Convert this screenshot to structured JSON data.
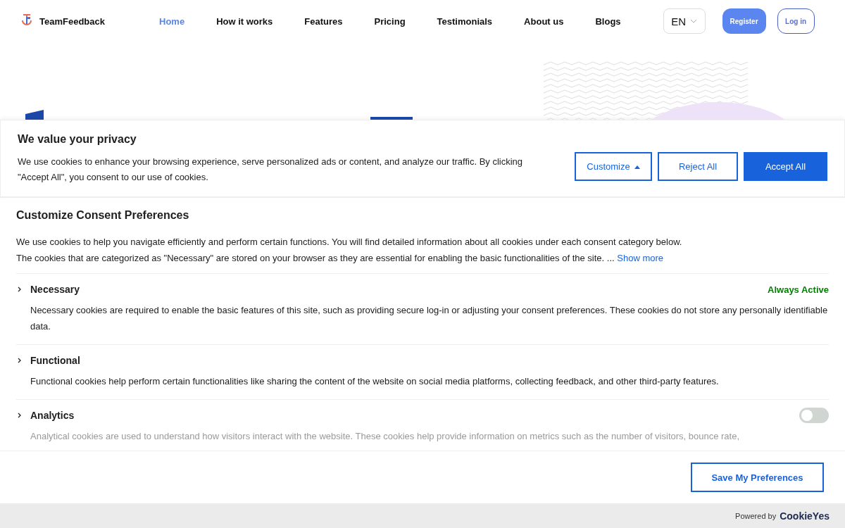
{
  "nav": {
    "brand": "TeamFeedback",
    "items": [
      {
        "label": "Home",
        "selected": true
      },
      {
        "label": "How it works",
        "selected": false
      },
      {
        "label": "Features",
        "selected": false
      },
      {
        "label": "Pricing",
        "selected": false
      },
      {
        "label": "Testimonials",
        "selected": false
      },
      {
        "label": "About us",
        "selected": false
      },
      {
        "label": "Blogs",
        "selected": false
      }
    ],
    "language": "EN",
    "register": "Register",
    "login": "Log in"
  },
  "banner": {
    "title": "We value your privacy",
    "text": "We use cookies to enhance your browsing experience, serve personalized ads or content, and analyze our traffic. By clicking \"Accept All\", you consent to our use of cookies.",
    "customize": {
      "label": "Customize",
      "expanded": true
    },
    "reject": "Reject All",
    "accept": "Accept All"
  },
  "preferences": {
    "title": "Customize Consent Preferences",
    "intro": "We use cookies to help you navigate efficiently and perform certain functions. You will find detailed information about all cookies under each consent category below.",
    "intro2": "The cookies that are categorized as \"Necessary\" are stored on your browser as they are essential for enabling the basic functionalities of the site. ...",
    "show_more": "Show more",
    "categories": [
      {
        "name": "Necessary",
        "kind": "always",
        "status": "Always Active",
        "expanded": false,
        "description": "Necessary cookies are required to enable the basic features of this site, such as providing secure log-in or adjusting your consent preferences. These cookies do not store any personally identifiable data."
      },
      {
        "name": "Functional",
        "kind": "plain",
        "expanded": false,
        "description": "Functional cookies help perform certain functionalities like sharing the content of the website on social media platforms, collecting feedback, and other third-party features."
      },
      {
        "name": "Analytics",
        "kind": "toggle",
        "on": false,
        "expanded": false,
        "description": "Analytical cookies are used to understand how visitors interact with the website. These cookies help provide information on metrics such as the number of visitors, bounce rate,"
      }
    ],
    "save": "Save My Preferences"
  },
  "footer": {
    "powered_by": "Powered by",
    "brand": "CookieYes"
  }
}
